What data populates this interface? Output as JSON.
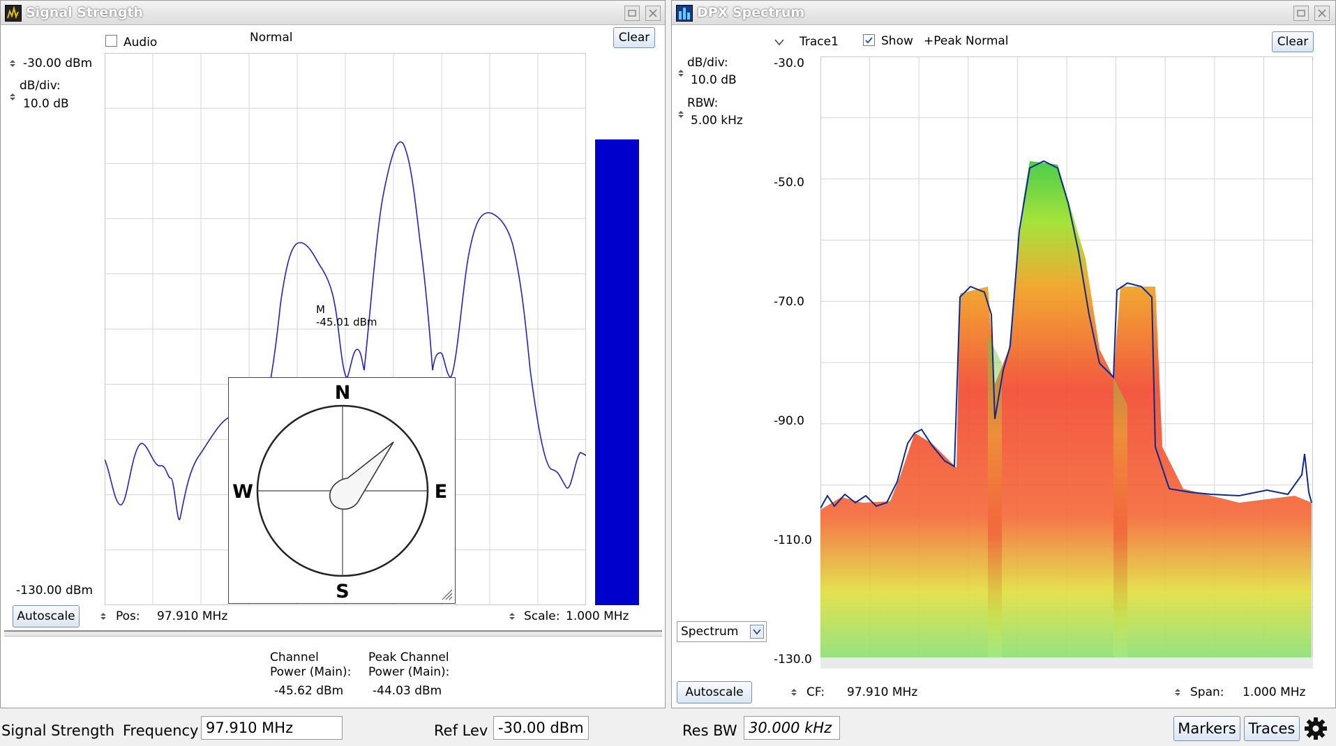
{
  "left_panel": {
    "title": "Signal Strength",
    "audio_label": "Audio",
    "mode_label": "Normal",
    "clear_label": "Clear",
    "ref_level": "-30.00 dBm",
    "dbdiv_label": "dB/div:",
    "dbdiv_value": "10.0 dB",
    "bottom_level": "-130.00 dBm",
    "marker_label": "M",
    "marker_value": "-45.01 dBm",
    "compass": {
      "n": "N",
      "s": "S",
      "e": "E",
      "w": "W"
    },
    "autoscale_label": "Autoscale",
    "pos_label": "Pos:",
    "pos_value": "97.910 MHz",
    "scale_label": "Scale:",
    "scale_value": "1.000 MHz",
    "channel_power_label_1": "Channel",
    "channel_power_label_2": "Power (Main):",
    "channel_power_value": "-45.62 dBm",
    "peak_power_label_1": "Peak Channel",
    "peak_power_label_2": "Power (Main):",
    "peak_power_value": "-44.03 dBm",
    "bar_color": "#0000cc",
    "trace_color": "#2323b8"
  },
  "right_panel": {
    "title": "DPX Spectrum",
    "trace_label": "Trace1",
    "show_label": "Show",
    "detector_label": "+Peak Normal",
    "clear_label": "Clear",
    "dbdiv_label": "dB/div:",
    "dbdiv_value": "10.0 dB",
    "rbw_label": "RBW:",
    "rbw_value": "5.00 kHz",
    "y_ticks": [
      "-30.0",
      "-50.0",
      "-70.0",
      "-90.0",
      "-110.0",
      "-130.0"
    ],
    "view_select": "Spectrum",
    "autoscale_label": "Autoscale",
    "cf_label": "CF:",
    "cf_value": "97.910 MHz",
    "span_label": "Span:",
    "span_value": "1.000 MHz"
  },
  "bottom_bar": {
    "mode_label": "Signal Strength",
    "frequency_label": "Frequency",
    "frequency_value": "97.910 MHz",
    "reflev_label": "Ref Lev",
    "reflev_value": "-30.00 dBm",
    "resbw_label": "Res BW",
    "resbw_value": "30.000 kHz",
    "markers_label": "Markers",
    "traces_label": "Traces"
  }
}
